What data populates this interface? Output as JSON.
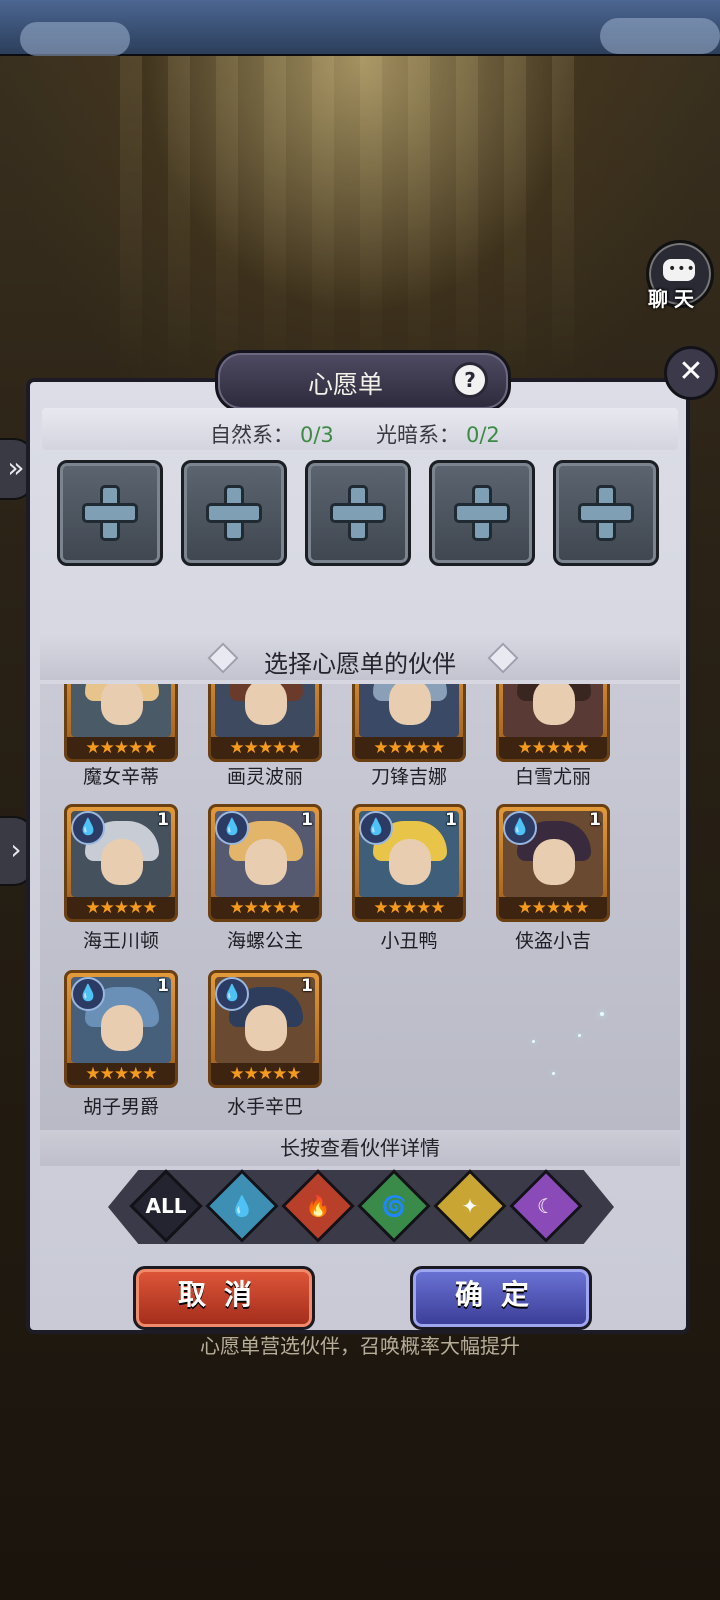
{
  "header": {
    "chat_label": "聊天",
    "chat_first": "聊",
    "chat_second": "天"
  },
  "dialog": {
    "title": "心愿单",
    "help_glyph": "?",
    "close_glyph": "✕",
    "counts": [
      {
        "label": "自然系：",
        "value": "0/3"
      },
      {
        "label": "光暗系：",
        "value": "0/2"
      }
    ],
    "select_header": "选择心愿单的伙伴",
    "hint": "长按查看伙伴详情",
    "cancel_label": "取消",
    "confirm_label": "确定"
  },
  "partners": [
    {
      "name": "魔女辛蒂",
      "level": "",
      "stars": "★★★★★",
      "hair": "#e6c48b",
      "bg": "#4a5a66"
    },
    {
      "name": "画灵波丽",
      "level": "",
      "stars": "★★★★★",
      "hair": "#6a3a2a",
      "bg": "#3d4a60"
    },
    {
      "name": "刀锋吉娜",
      "level": "",
      "stars": "★★★★★",
      "hair": "#8aa0b8",
      "bg": "#3a4a66"
    },
    {
      "name": "白雪尤丽",
      "level": "",
      "stars": "★★★★★",
      "hair": "#3a2620",
      "bg": "#5a3a34"
    },
    {
      "name": "海王川顿",
      "level": "1",
      "stars": "★★★★★",
      "hair": "#c8ccd4",
      "bg": "#45525e"
    },
    {
      "name": "海螺公主",
      "level": "1",
      "stars": "★★★★★",
      "hair": "#e2b56a",
      "bg": "#565a70"
    },
    {
      "name": "小丑鸭",
      "level": "1",
      "stars": "★★★★★",
      "hair": "#e8c449",
      "bg": "#3e5e7a"
    },
    {
      "name": "侠盗小吉",
      "level": "1",
      "stars": "★★★★★",
      "hair": "#3a2a3e",
      "bg": "#6a4a30"
    },
    {
      "name": "胡子男爵",
      "level": "1",
      "stars": "★★★★★",
      "hair": "#6a90b8",
      "bg": "#46607c"
    },
    {
      "name": "水手辛巴",
      "level": "1",
      "stars": "★★★★★",
      "hair": "#2f3d5c",
      "bg": "#6a4a30"
    }
  ],
  "filters": [
    {
      "label": "ALL",
      "icon": "all-icon",
      "color": "#242430"
    },
    {
      "label": "💧",
      "icon": "water-element-icon",
      "color": "#3d8fb3"
    },
    {
      "label": "🔥",
      "icon": "fire-element-icon",
      "color": "#b8402a"
    },
    {
      "label": "🌀",
      "icon": "wind-element-icon",
      "color": "#3a8a4a"
    },
    {
      "label": "✦",
      "icon": "light-element-icon",
      "color": "#c9a634"
    },
    {
      "label": "☾",
      "icon": "dark-element-icon",
      "color": "#8a4ab8"
    }
  ],
  "bottom_text": "心愿单营选伙伴，召唤概率大幅提升"
}
